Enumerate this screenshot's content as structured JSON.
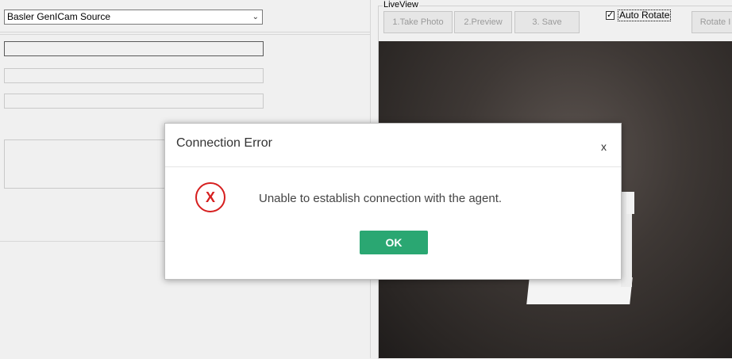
{
  "left_panel": {
    "source_select": {
      "value": "Basler GenICam Source",
      "chevron_icon": "chevron-down-icon"
    }
  },
  "liveview": {
    "group_label": "LiveView",
    "buttons": [
      {
        "label": "1.Take Photo"
      },
      {
        "label": "2.Preview"
      },
      {
        "label": "3. Save"
      },
      {
        "label": "Rotate I"
      }
    ],
    "auto_rotate": {
      "label": "Auto Rotate",
      "checked": true
    }
  },
  "dialog": {
    "title": "Connection Error",
    "close_label": "x",
    "icon": "error-x-icon",
    "icon_glyph": "X",
    "message": "Unable to establish connection with the agent.",
    "ok_label": "OK",
    "colors": {
      "error": "#d61f1f",
      "ok_button": "#2aa772"
    }
  }
}
